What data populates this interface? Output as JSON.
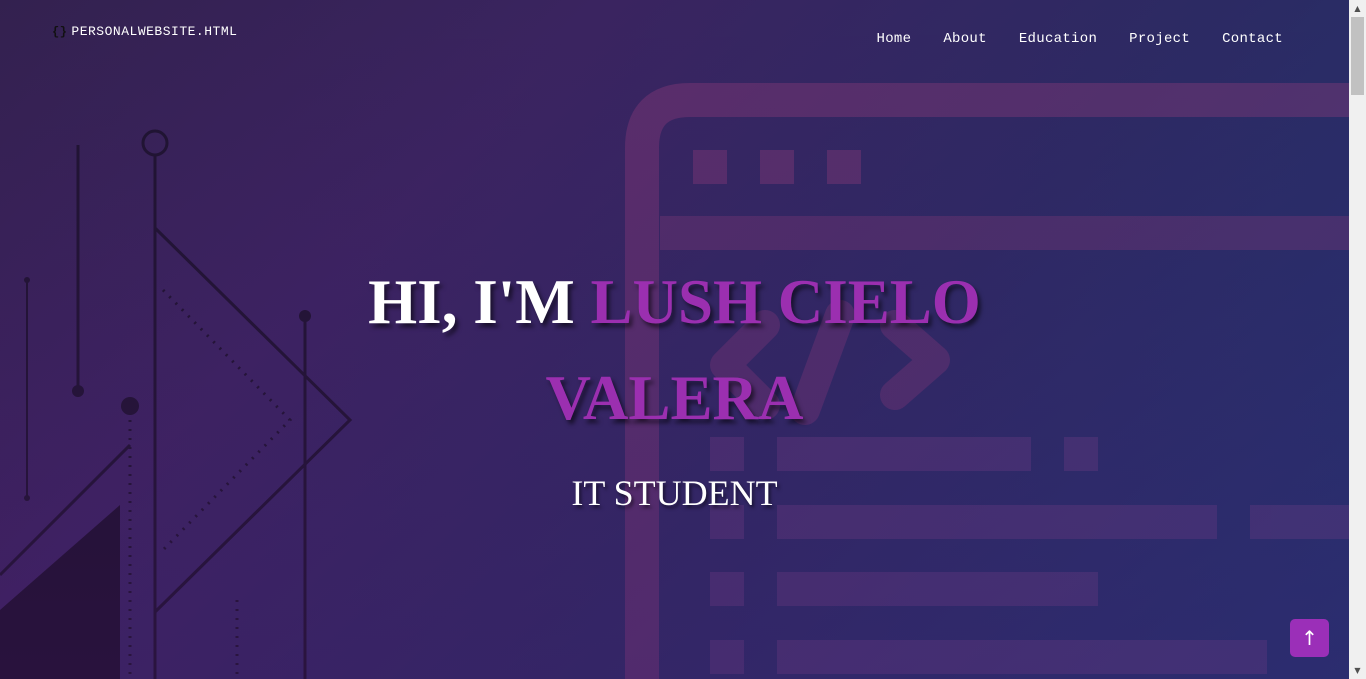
{
  "logo": {
    "text": "PERSONALWEBSITE.HTML",
    "braces": "{}",
    "icon": "braces-icon"
  },
  "nav": {
    "home": "Home",
    "about": "About",
    "education": "Education",
    "project": "Project",
    "contact": "Contact"
  },
  "hero": {
    "greeting": "HI, I'M ",
    "name_line1": "LUSH CIELO",
    "name_line2": "VALERA",
    "subtitle": "IT STUDENT"
  },
  "back_to_top": {
    "icon": "arrow-up-icon",
    "glyph": "↑"
  },
  "scrollbar": {
    "up": "▲",
    "down": "▼"
  },
  "colors": {
    "accent": "#9b2fb0",
    "button": "#9b2fb8",
    "text": "#ffffff"
  }
}
